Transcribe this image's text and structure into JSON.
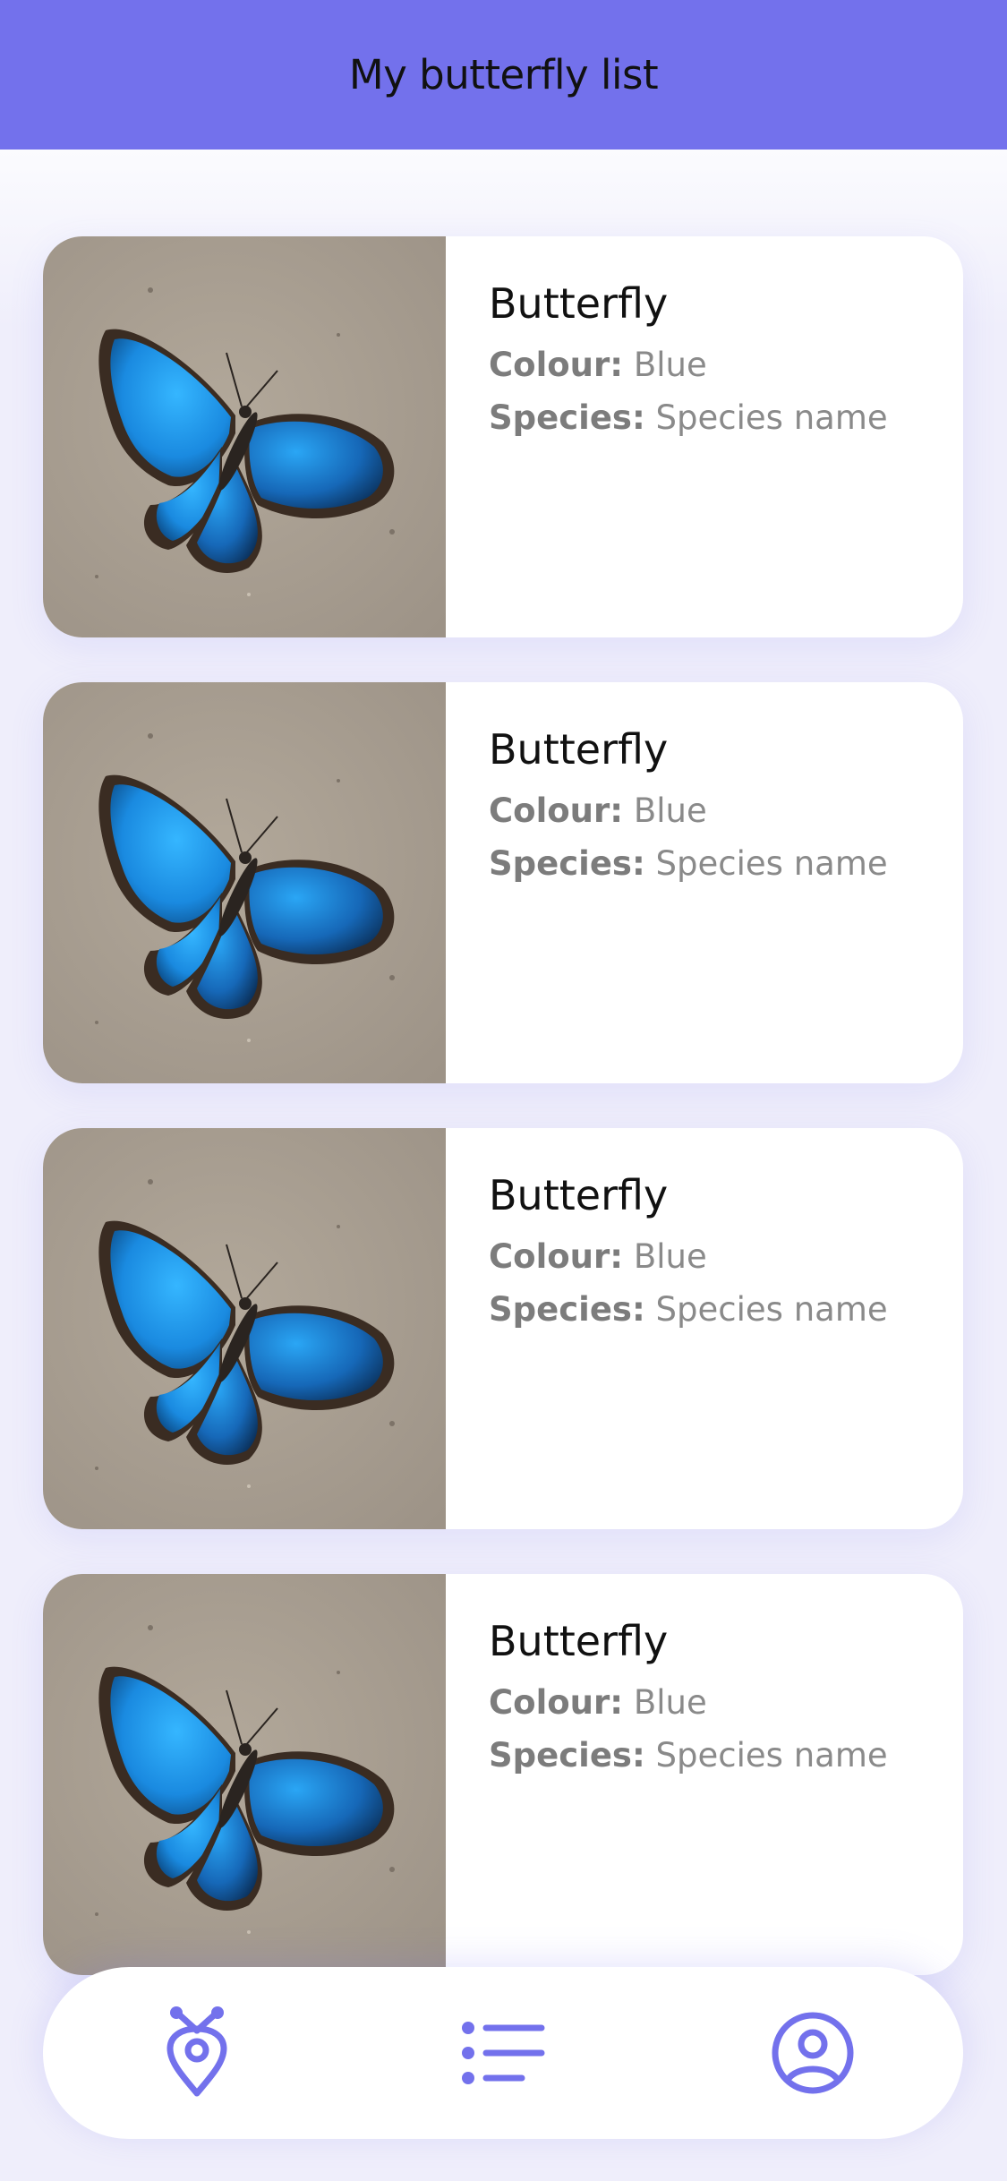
{
  "header": {
    "title": "My butterfly list"
  },
  "cards": [
    {
      "title": "Butterfly",
      "colour_label": "Colour:",
      "colour_value": "Blue",
      "species_label": "Species:",
      "species_value": "Species name"
    },
    {
      "title": "Butterfly",
      "colour_label": "Colour:",
      "colour_value": "Blue",
      "species_label": "Species:",
      "species_value": "Species name"
    },
    {
      "title": "Butterfly",
      "colour_label": "Colour:",
      "colour_value": "Blue",
      "species_label": "Species:",
      "species_value": "Species name"
    },
    {
      "title": "Butterfly",
      "colour_label": "Colour:",
      "colour_value": "Blue",
      "species_label": "Species:",
      "species_value": "Species name"
    }
  ],
  "bottom_nav": {
    "items": [
      {
        "icon": "butterfly-location-icon",
        "active": false
      },
      {
        "icon": "list-icon",
        "active": true
      },
      {
        "icon": "profile-icon",
        "active": false
      }
    ]
  },
  "colors": {
    "accent": "#7371ec",
    "background": "#f6f6fd",
    "card": "#ffffff",
    "wing": "#1e9bf0"
  }
}
